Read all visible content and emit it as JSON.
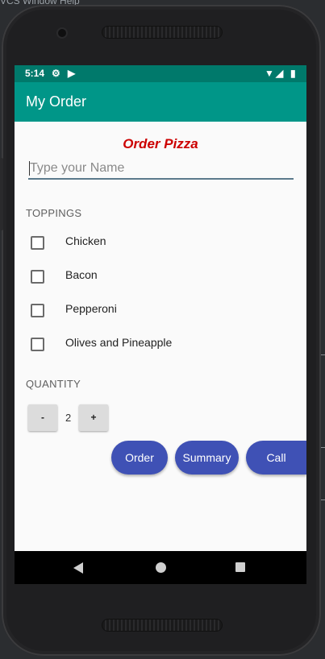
{
  "ide": {
    "menu_text": "VCS  Window  Help"
  },
  "status_bar": {
    "time": "5:14",
    "icons": [
      "gear-icon",
      "play-store-icon",
      "wifi-icon",
      "signal-icon",
      "battery-icon"
    ]
  },
  "app_bar": {
    "title": "My Order"
  },
  "form": {
    "title": "Order Pizza",
    "name_placeholder": "Type your Name",
    "toppings_header": "TOPPINGS",
    "toppings": [
      {
        "label": "Chicken",
        "checked": false
      },
      {
        "label": "Bacon",
        "checked": false
      },
      {
        "label": "Pepperoni",
        "checked": false
      },
      {
        "label": "Olives and Pineapple",
        "checked": false
      }
    ],
    "quantity_header": "QUANTITY",
    "decrement_label": "-",
    "quantity": "2",
    "increment_label": "+"
  },
  "actions": {
    "order_label": "Order",
    "summary_label": "Summary",
    "call_label": "Call"
  },
  "colors": {
    "status_bar": "#00796b",
    "app_bar": "#009688",
    "title_red": "#cc0000",
    "action_blue": "#3f51b5"
  }
}
